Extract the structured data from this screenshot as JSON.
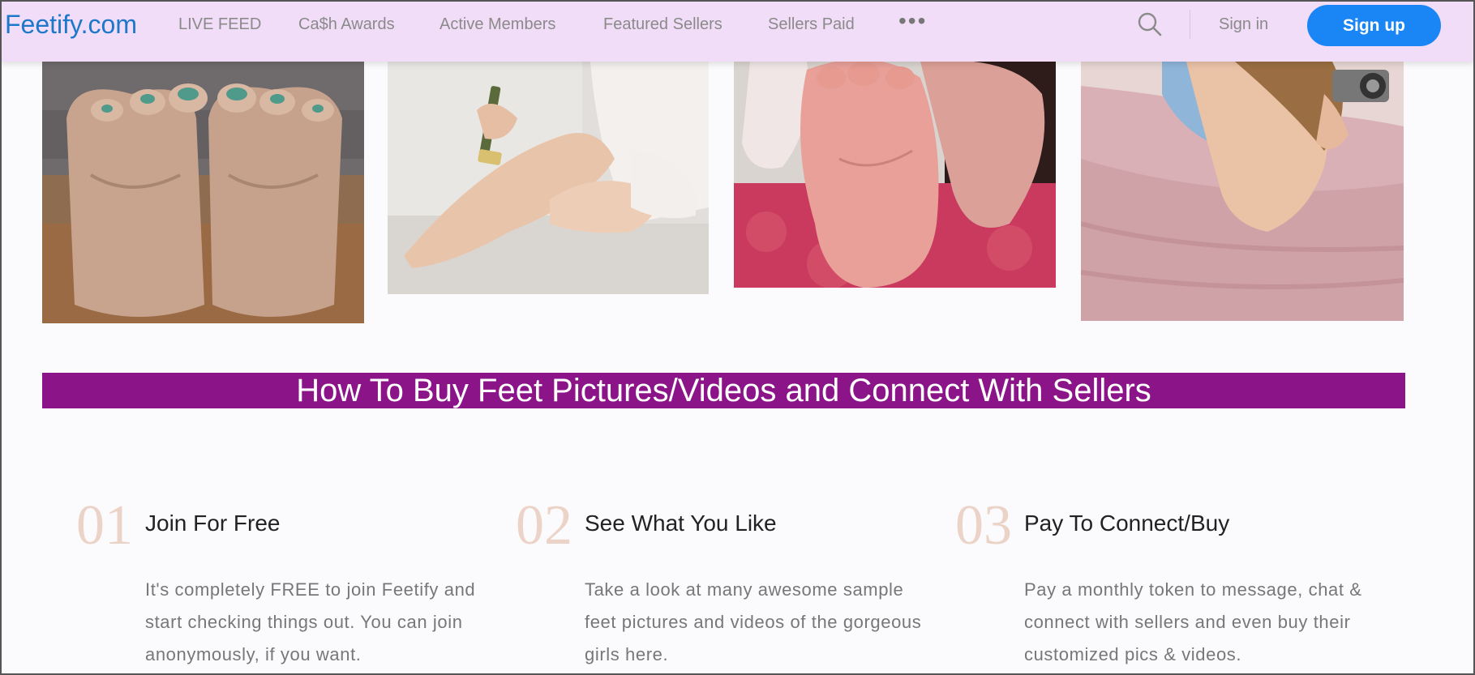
{
  "header": {
    "logo": "Feetify.com",
    "nav": [
      "LIVE FEED",
      "Ca$h Awards",
      "Active Members",
      "Featured Sellers",
      "Sellers Paid"
    ],
    "more": "•••",
    "sign_in": "Sign in",
    "sign_up": "Sign up"
  },
  "photos": [
    {
      "name": "soles-green-toenails-photo"
    },
    {
      "name": "woman-shaving-legs-photo"
    },
    {
      "name": "feet-soles-closeup-photo"
    },
    {
      "name": "woman-with-camera-photo"
    }
  ],
  "banner": {
    "title": "How To Buy Feet Pictures/Videos and Connect With Sellers"
  },
  "steps": [
    {
      "num": "01",
      "title": "Join For Free",
      "text": "It's completely FREE to join Feetify and start checking things out. You can join anonymously, if you want."
    },
    {
      "num": "02",
      "title": "See What You Like",
      "text": "Take a look at many awesome sample feet pictures and videos of the gorgeous girls here."
    },
    {
      "num": "03",
      "title": "Pay To Connect/Buy",
      "text": "Pay a monthly token to message, chat & connect with sellers and even buy their customized pics & videos."
    }
  ],
  "colors": {
    "header_bg": "#f1ddf7",
    "accent_blue": "#1a86f5",
    "banner_bg": "#8b1488",
    "step_number": "#ecd3c8"
  }
}
